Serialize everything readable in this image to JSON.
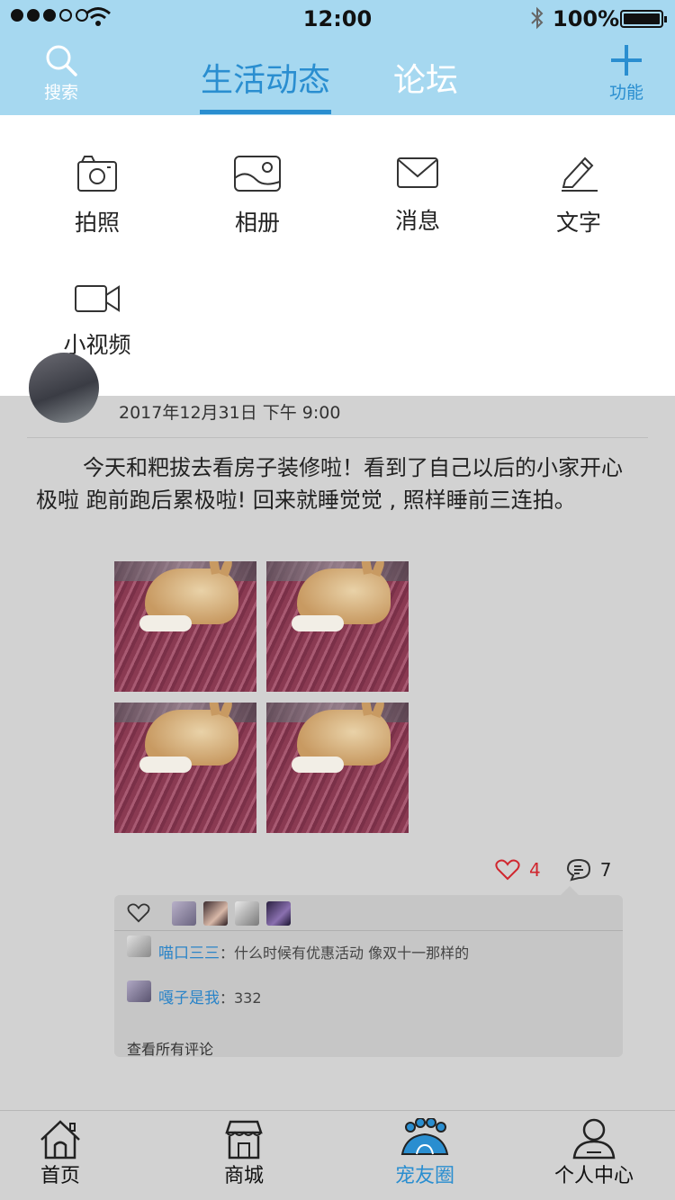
{
  "status_bar": {
    "time": "12:00",
    "battery": "100%"
  },
  "header": {
    "search_label": "搜索",
    "function_label": "功能",
    "tabs": [
      {
        "label": "生活动态",
        "active": true
      },
      {
        "label": "论坛",
        "active": false
      }
    ]
  },
  "menu": {
    "items": [
      {
        "label": "拍照",
        "icon": "camera-icon"
      },
      {
        "label": "相册",
        "icon": "album-icon"
      },
      {
        "label": "消息",
        "icon": "envelope-icon"
      },
      {
        "label": "文字",
        "icon": "pencil-icon"
      },
      {
        "label": "小视频",
        "icon": "video-icon"
      }
    ]
  },
  "post": {
    "date": "2017年12月31日  下午 9:00",
    "text": "今天和粑拔去看房子装修啦！看到了自己以后的小家开心极啦 跑前跑后累极啦! 回来就睡觉觉 , 照样睡前三连拍。",
    "photo_count": 4,
    "like_count": "4",
    "comment_count": "7",
    "comments": [
      {
        "name": "喵口三三",
        "text": "：什么时候有优惠活动 像双十一那样的"
      },
      {
        "name": "嘎子是我",
        "text": "：332"
      }
    ],
    "view_all": "查看所有评论"
  },
  "tabbar": {
    "items": [
      {
        "label": "首页",
        "active": false
      },
      {
        "label": "商城",
        "active": false
      },
      {
        "label": "宠友圈",
        "active": true
      },
      {
        "label": "个人中心",
        "active": false
      }
    ]
  },
  "colors": {
    "accent": "#2a8ed0",
    "header_bg": "#a6d8f0",
    "like": "#d0262e"
  }
}
